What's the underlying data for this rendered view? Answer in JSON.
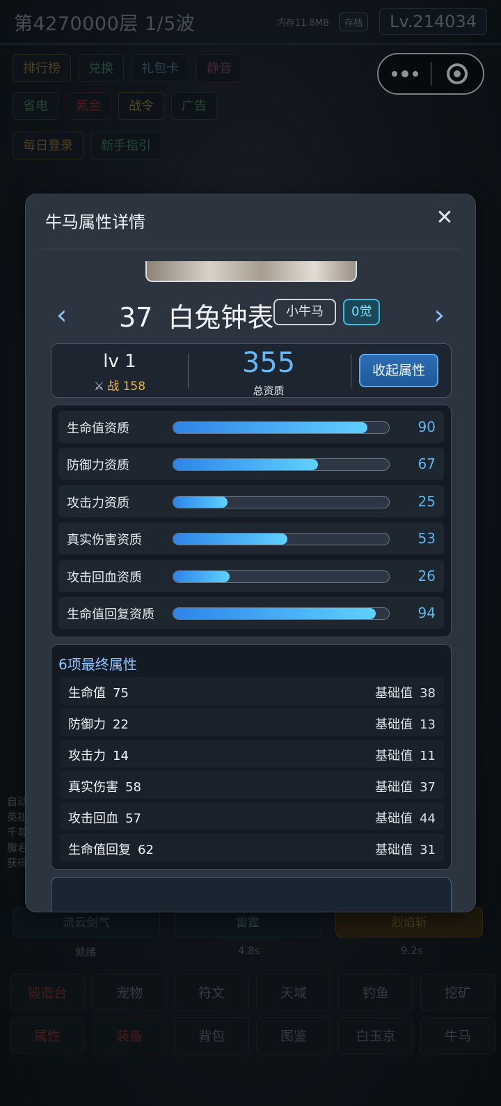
{
  "background": {
    "title": "第4270000层 1/5波",
    "memory": "内存11.8MB",
    "save_label": "存档",
    "level": "Lv.214034",
    "row1": [
      "排行榜",
      "兑换",
      "礼包卡",
      "静音"
    ],
    "row2": [
      "省电",
      "氪金",
      "战令",
      "广告"
    ],
    "row3": [
      "每日登录",
      "新手指引"
    ],
    "side_text": [
      "自动",
      "英雄",
      "千尊",
      "魔君",
      "获得"
    ],
    "skills": [
      "流云剑气",
      "雷霆",
      "烈焰斩"
    ],
    "skill_sub": [
      "就绪",
      "4.8s",
      "9.2s"
    ],
    "grid_row1": [
      "锻造台",
      "宠物",
      "符文",
      "天域",
      "钓鱼",
      "挖矿"
    ],
    "grid_row2": [
      "属性",
      "装备",
      "背包",
      "图鉴",
      "白玉京",
      "牛马"
    ]
  },
  "modal": {
    "title": "牛马属性详情",
    "close_symbol": "✕",
    "prev_symbol": "‹",
    "next_symbol": "›",
    "hero_number": "37",
    "hero_name": "白兔钟表",
    "type_tag": "小牛马",
    "awaken_tag": "0觉",
    "level": "lv 1",
    "power_label": "战",
    "power_value": "158",
    "total_quality": "355",
    "total_quality_label": "总资质",
    "collapse_label": "收起属性",
    "qualities": [
      {
        "label": "生命值资质",
        "value": 90
      },
      {
        "label": "防御力资质",
        "value": 67
      },
      {
        "label": "攻击力资质",
        "value": 25
      },
      {
        "label": "真实伤害资质",
        "value": 53
      },
      {
        "label": "攻击回血资质",
        "value": 26
      },
      {
        "label": "生命值回复资质",
        "value": 94
      }
    ],
    "final_title": "6项最终属性",
    "base_label": "基础值",
    "finals": [
      {
        "name": "生命值",
        "value": "75",
        "base": "38"
      },
      {
        "name": "防御力",
        "value": "22",
        "base": "13"
      },
      {
        "name": "攻击力",
        "value": "14",
        "base": "11"
      },
      {
        "name": "真实伤害",
        "value": "58",
        "base": "37"
      },
      {
        "name": "攻击回血",
        "value": "57",
        "base": "44"
      },
      {
        "name": "生命值回复",
        "value": "62",
        "base": "31"
      }
    ]
  },
  "colors": {
    "accent": "#63b8ff",
    "bar_start": "#2e84e8",
    "bar_end": "#5fd0ff",
    "power": "#f0b850"
  }
}
